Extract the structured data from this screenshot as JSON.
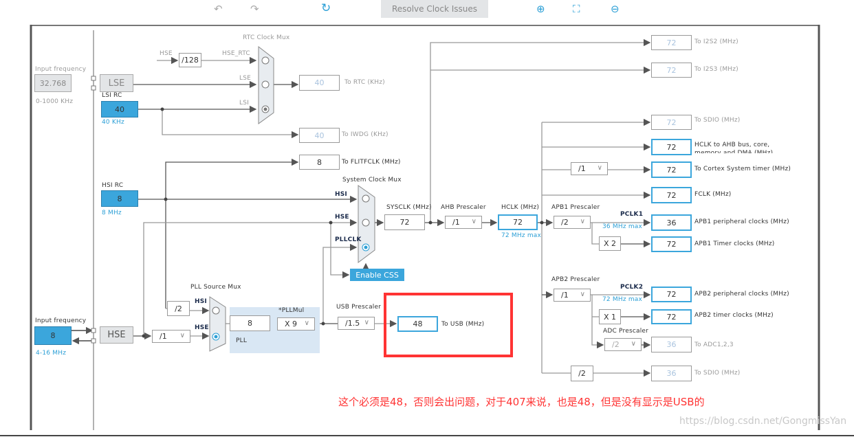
{
  "toolbar": {
    "undo_icon": "undo-icon",
    "redo_icon": "redo-icon",
    "refresh_icon": "refresh-icon",
    "resolve_label": "Resolve Clock Issues",
    "zoom_in_icon": "zoom-in-icon",
    "fit_icon": "fit-screen-icon",
    "zoom_out_icon": "zoom-out-icon"
  },
  "lse_input": {
    "label": "Input frequency",
    "value": "32.768",
    "range": "0-1000 KHz",
    "name": "LSE"
  },
  "lsi": {
    "label": "LSI RC",
    "value": "40",
    "unit": "40 KHz"
  },
  "rtc": {
    "mux_label": "RTC Clock Mux",
    "hse_label": "HSE",
    "div": "/128",
    "hse_rtc": "HSE_RTC",
    "lse": "LSE",
    "lsi": "LSI",
    "value": "40",
    "out_label": "To RTC (KHz)"
  },
  "iwdg": {
    "value": "40",
    "label": "To IWDG (KHz)"
  },
  "flitf": {
    "value": "8",
    "label": "To FLITFCLK (MHz)"
  },
  "hsi": {
    "label": "HSI RC",
    "value": "8",
    "unit": "8 MHz"
  },
  "sysmux": {
    "label": "System Clock Mux",
    "hsi": "HSI",
    "hse": "HSE",
    "pllclk": "PLLCLK",
    "enable_css": "Enable CSS"
  },
  "sysclk": {
    "label": "SYSCLK (MHz)",
    "value": "72"
  },
  "ahb": {
    "label": "AHB Prescaler",
    "value": "/1"
  },
  "hclk": {
    "label": "HCLK (MHz)",
    "value": "72",
    "max": "72 MHz max"
  },
  "apb1": {
    "label": "APB1 Prescaler",
    "value": "/2",
    "pclk": "PCLK1",
    "max": "36 MHz max",
    "mult": "X 2"
  },
  "apb2": {
    "label": "APB2 Prescaler",
    "value": "/1",
    "pclk": "PCLK2",
    "max": "72 MHz max",
    "mult": "X 1"
  },
  "adc": {
    "label": "ADC Prescaler",
    "value": "/2"
  },
  "cortex_div": "/1",
  "sdio_div": "/2",
  "outputs": [
    {
      "value": "72",
      "label": "To I2S2 (MHz)"
    },
    {
      "value": "72",
      "label": "To I2S3 (MHz)"
    },
    {
      "value": "72",
      "label": "To SDIO (MHz)"
    },
    {
      "value": "72",
      "label": "HCLK to AHB bus, core, memory and DMA (MHz)"
    },
    {
      "value": "72",
      "label": "To Cortex System timer (MHz)"
    },
    {
      "value": "72",
      "label": "FCLK (MHz)"
    },
    {
      "value": "36",
      "label": "APB1 peripheral clocks (MHz)"
    },
    {
      "value": "72",
      "label": "APB1 Timer clocks (MHz)"
    },
    {
      "value": "72",
      "label": "APB2 peripheral clocks (MHz)"
    },
    {
      "value": "72",
      "label": "APB2 timer clocks (MHz)"
    },
    {
      "value": "36",
      "label": "To ADC1,2,3"
    },
    {
      "value": "36",
      "label": "To SDIO (MHz)"
    }
  ],
  "hse_input": {
    "label": "Input frequency",
    "value": "8",
    "range": "4-16 MHz",
    "name": "HSE",
    "div": "/1"
  },
  "pll": {
    "mux_label": "PLL Source Mux",
    "hsi_div": "/2",
    "hsi": "HSI",
    "hse": "HSE",
    "input": "8",
    "mul_label": "*PLLMul",
    "mul": "X 9",
    "name": "PLL"
  },
  "usb": {
    "label": "USB Prescaler",
    "div": "/1.5",
    "value": "48",
    "out_label": "To USB (MHz)"
  },
  "annotation": "这个必须是48，否则会出问题，对于407来说，也是48，但是没有显示是USB的",
  "watermark": "https://blog.csdn.net/GongmissYan",
  "colors": {
    "accent": "#3ba6dc",
    "highlight": "#ff3333"
  }
}
